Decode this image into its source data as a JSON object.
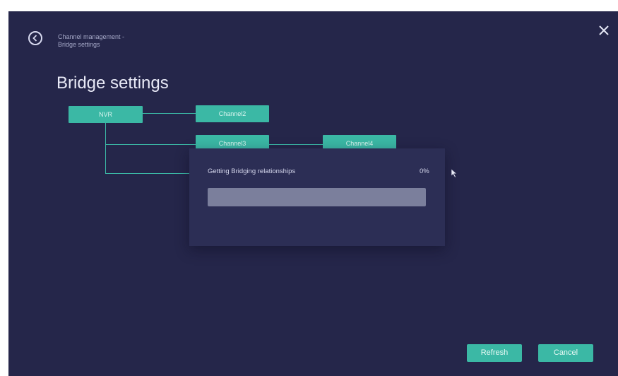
{
  "header": {
    "breadcrumb_line1": "Channel management -",
    "breadcrumb_line2": "Bridge settings"
  },
  "page": {
    "title": "Bridge settings"
  },
  "diagram": {
    "root": "NVR",
    "channels": [
      "Channel2",
      "Channel3",
      "Channel4"
    ]
  },
  "dialog": {
    "message": "Getting Bridging relationships",
    "progress_text": "0%",
    "progress": 0
  },
  "actions": {
    "refresh": "Refresh",
    "cancel": "Cancel"
  },
  "colors": {
    "background": "#25264a",
    "accent": "#3bb8a5",
    "dialog": "#2c2e55"
  }
}
